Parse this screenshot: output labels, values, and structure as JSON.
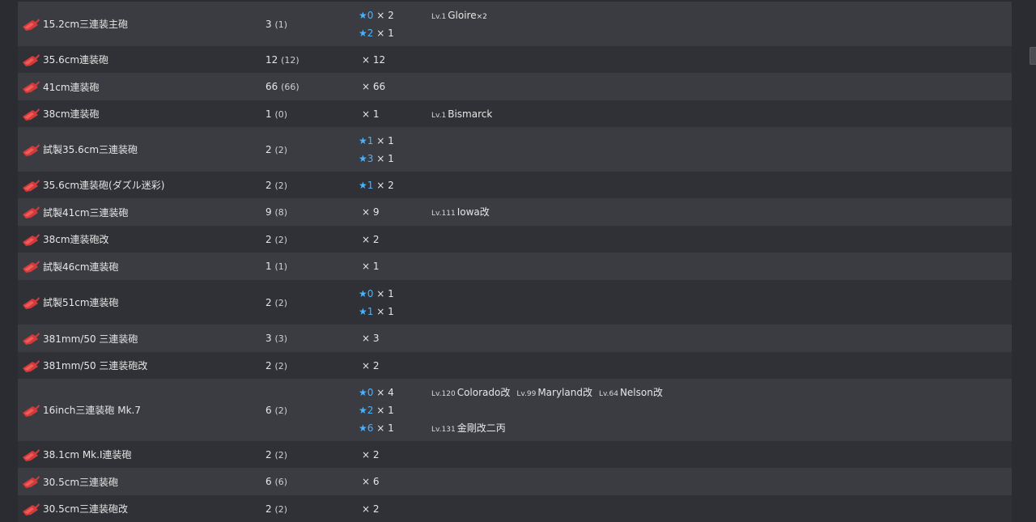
{
  "icon": "main-gun-icon",
  "colors": {
    "row_odd": "#3a3c42",
    "row_even": "#2f3136",
    "star": "#4ab3ff",
    "icon": "#d33a3a"
  },
  "rows": [
    {
      "name": "15.2cm三連装主砲",
      "count": "3",
      "count_paren": "(1)",
      "stars": [
        {
          "star": "★0",
          "mult": " × 2"
        },
        {
          "star": "★2",
          "mult": " × 1"
        }
      ],
      "ships": [
        [
          {
            "lv": "Lv.1",
            "name": "Gloire",
            "mult": "×2"
          }
        ],
        []
      ]
    },
    {
      "name": "35.6cm連装砲",
      "count": "12",
      "count_paren": "(12)",
      "stars": [
        {
          "star": "",
          "mult": "× 12"
        }
      ],
      "ships": [
        []
      ]
    },
    {
      "name": "41cm連装砲",
      "count": "66",
      "count_paren": "(66)",
      "stars": [
        {
          "star": "",
          "mult": "× 66"
        }
      ],
      "ships": [
        []
      ]
    },
    {
      "name": "38cm連装砲",
      "count": "1",
      "count_paren": "(0)",
      "stars": [
        {
          "star": "",
          "mult": "× 1"
        }
      ],
      "ships": [
        [
          {
            "lv": "Lv.1",
            "name": "Bismarck",
            "mult": ""
          }
        ]
      ]
    },
    {
      "name": "試製35.6cm三連装砲",
      "count": "2",
      "count_paren": "(2)",
      "stars": [
        {
          "star": "★1",
          "mult": " × 1"
        },
        {
          "star": "★3",
          "mult": " × 1"
        }
      ],
      "ships": [
        [],
        []
      ]
    },
    {
      "name": "35.6cm連装砲(ダズル迷彩)",
      "count": "2",
      "count_paren": "(2)",
      "stars": [
        {
          "star": "★1",
          "mult": " × 2"
        }
      ],
      "ships": [
        []
      ]
    },
    {
      "name": "試製41cm三連装砲",
      "count": "9",
      "count_paren": "(8)",
      "stars": [
        {
          "star": "",
          "mult": "× 9"
        }
      ],
      "ships": [
        [
          {
            "lv": "Lv.111",
            "name": "Iowa改",
            "mult": ""
          }
        ]
      ]
    },
    {
      "name": "38cm連装砲改",
      "count": "2",
      "count_paren": "(2)",
      "stars": [
        {
          "star": "",
          "mult": "× 2"
        }
      ],
      "ships": [
        []
      ]
    },
    {
      "name": "試製46cm連装砲",
      "count": "1",
      "count_paren": "(1)",
      "stars": [
        {
          "star": "",
          "mult": "× 1"
        }
      ],
      "ships": [
        []
      ]
    },
    {
      "name": "試製51cm連装砲",
      "count": "2",
      "count_paren": "(2)",
      "stars": [
        {
          "star": "★0",
          "mult": " × 1"
        },
        {
          "star": "★1",
          "mult": " × 1"
        }
      ],
      "ships": [
        [],
        []
      ]
    },
    {
      "name": "381mm/50 三連装砲",
      "count": "3",
      "count_paren": "(3)",
      "stars": [
        {
          "star": "",
          "mult": "× 3"
        }
      ],
      "ships": [
        []
      ]
    },
    {
      "name": "381mm/50 三連装砲改",
      "count": "2",
      "count_paren": "(2)",
      "stars": [
        {
          "star": "",
          "mult": "× 2"
        }
      ],
      "ships": [
        []
      ]
    },
    {
      "name": "16inch三連装砲 Mk.7",
      "count": "6",
      "count_paren": "(2)",
      "stars": [
        {
          "star": "★0",
          "mult": " × 4"
        },
        {
          "star": "★2",
          "mult": " × 1"
        },
        {
          "star": "★6",
          "mult": " × 1"
        }
      ],
      "ships": [
        [
          {
            "lv": "Lv.120",
            "name": "Colorado改",
            "mult": ""
          },
          {
            "lv": "Lv.99",
            "name": "Maryland改",
            "mult": ""
          },
          {
            "lv": "Lv.64",
            "name": "Nelson改",
            "mult": ""
          }
        ],
        [],
        [
          {
            "lv": "Lv.131",
            "name": "金剛改二丙",
            "mult": ""
          }
        ]
      ]
    },
    {
      "name": "38.1cm Mk.I連装砲",
      "count": "2",
      "count_paren": "(2)",
      "stars": [
        {
          "star": "",
          "mult": "× 2"
        }
      ],
      "ships": [
        []
      ]
    },
    {
      "name": "30.5cm三連装砲",
      "count": "6",
      "count_paren": "(6)",
      "stars": [
        {
          "star": "",
          "mult": "× 6"
        }
      ],
      "ships": [
        []
      ]
    },
    {
      "name": "30.5cm三連装砲改",
      "count": "2",
      "count_paren": "(2)",
      "stars": [
        {
          "star": "",
          "mult": "× 2"
        }
      ],
      "ships": [
        []
      ]
    }
  ]
}
